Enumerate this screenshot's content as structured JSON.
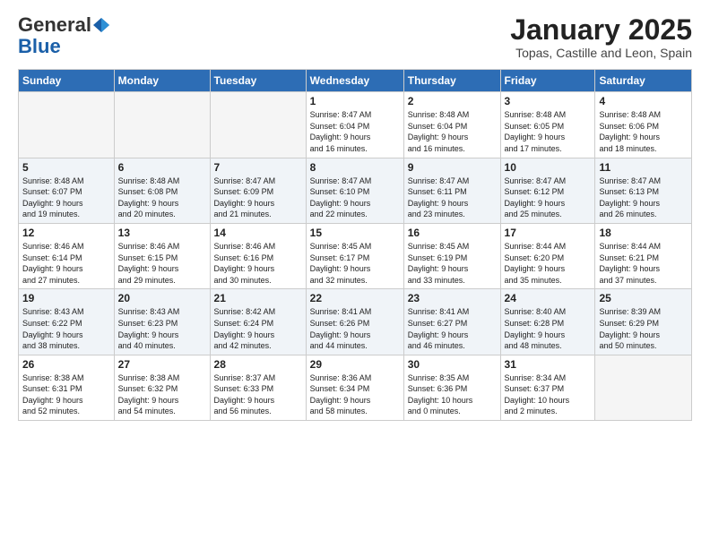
{
  "logo": {
    "general": "General",
    "blue": "Blue"
  },
  "title": "January 2025",
  "subtitle": "Topas, Castille and Leon, Spain",
  "days_of_week": [
    "Sunday",
    "Monday",
    "Tuesday",
    "Wednesday",
    "Thursday",
    "Friday",
    "Saturday"
  ],
  "weeks": [
    [
      {
        "day": "",
        "info": ""
      },
      {
        "day": "",
        "info": ""
      },
      {
        "day": "",
        "info": ""
      },
      {
        "day": "1",
        "info": "Sunrise: 8:47 AM\nSunset: 6:04 PM\nDaylight: 9 hours\nand 16 minutes."
      },
      {
        "day": "2",
        "info": "Sunrise: 8:48 AM\nSunset: 6:04 PM\nDaylight: 9 hours\nand 16 minutes."
      },
      {
        "day": "3",
        "info": "Sunrise: 8:48 AM\nSunset: 6:05 PM\nDaylight: 9 hours\nand 17 minutes."
      },
      {
        "day": "4",
        "info": "Sunrise: 8:48 AM\nSunset: 6:06 PM\nDaylight: 9 hours\nand 18 minutes."
      }
    ],
    [
      {
        "day": "5",
        "info": "Sunrise: 8:48 AM\nSunset: 6:07 PM\nDaylight: 9 hours\nand 19 minutes."
      },
      {
        "day": "6",
        "info": "Sunrise: 8:48 AM\nSunset: 6:08 PM\nDaylight: 9 hours\nand 20 minutes."
      },
      {
        "day": "7",
        "info": "Sunrise: 8:47 AM\nSunset: 6:09 PM\nDaylight: 9 hours\nand 21 minutes."
      },
      {
        "day": "8",
        "info": "Sunrise: 8:47 AM\nSunset: 6:10 PM\nDaylight: 9 hours\nand 22 minutes."
      },
      {
        "day": "9",
        "info": "Sunrise: 8:47 AM\nSunset: 6:11 PM\nDaylight: 9 hours\nand 23 minutes."
      },
      {
        "day": "10",
        "info": "Sunrise: 8:47 AM\nSunset: 6:12 PM\nDaylight: 9 hours\nand 25 minutes."
      },
      {
        "day": "11",
        "info": "Sunrise: 8:47 AM\nSunset: 6:13 PM\nDaylight: 9 hours\nand 26 minutes."
      }
    ],
    [
      {
        "day": "12",
        "info": "Sunrise: 8:46 AM\nSunset: 6:14 PM\nDaylight: 9 hours\nand 27 minutes."
      },
      {
        "day": "13",
        "info": "Sunrise: 8:46 AM\nSunset: 6:15 PM\nDaylight: 9 hours\nand 29 minutes."
      },
      {
        "day": "14",
        "info": "Sunrise: 8:46 AM\nSunset: 6:16 PM\nDaylight: 9 hours\nand 30 minutes."
      },
      {
        "day": "15",
        "info": "Sunrise: 8:45 AM\nSunset: 6:17 PM\nDaylight: 9 hours\nand 32 minutes."
      },
      {
        "day": "16",
        "info": "Sunrise: 8:45 AM\nSunset: 6:19 PM\nDaylight: 9 hours\nand 33 minutes."
      },
      {
        "day": "17",
        "info": "Sunrise: 8:44 AM\nSunset: 6:20 PM\nDaylight: 9 hours\nand 35 minutes."
      },
      {
        "day": "18",
        "info": "Sunrise: 8:44 AM\nSunset: 6:21 PM\nDaylight: 9 hours\nand 37 minutes."
      }
    ],
    [
      {
        "day": "19",
        "info": "Sunrise: 8:43 AM\nSunset: 6:22 PM\nDaylight: 9 hours\nand 38 minutes."
      },
      {
        "day": "20",
        "info": "Sunrise: 8:43 AM\nSunset: 6:23 PM\nDaylight: 9 hours\nand 40 minutes."
      },
      {
        "day": "21",
        "info": "Sunrise: 8:42 AM\nSunset: 6:24 PM\nDaylight: 9 hours\nand 42 minutes."
      },
      {
        "day": "22",
        "info": "Sunrise: 8:41 AM\nSunset: 6:26 PM\nDaylight: 9 hours\nand 44 minutes."
      },
      {
        "day": "23",
        "info": "Sunrise: 8:41 AM\nSunset: 6:27 PM\nDaylight: 9 hours\nand 46 minutes."
      },
      {
        "day": "24",
        "info": "Sunrise: 8:40 AM\nSunset: 6:28 PM\nDaylight: 9 hours\nand 48 minutes."
      },
      {
        "day": "25",
        "info": "Sunrise: 8:39 AM\nSunset: 6:29 PM\nDaylight: 9 hours\nand 50 minutes."
      }
    ],
    [
      {
        "day": "26",
        "info": "Sunrise: 8:38 AM\nSunset: 6:31 PM\nDaylight: 9 hours\nand 52 minutes."
      },
      {
        "day": "27",
        "info": "Sunrise: 8:38 AM\nSunset: 6:32 PM\nDaylight: 9 hours\nand 54 minutes."
      },
      {
        "day": "28",
        "info": "Sunrise: 8:37 AM\nSunset: 6:33 PM\nDaylight: 9 hours\nand 56 minutes."
      },
      {
        "day": "29",
        "info": "Sunrise: 8:36 AM\nSunset: 6:34 PM\nDaylight: 9 hours\nand 58 minutes."
      },
      {
        "day": "30",
        "info": "Sunrise: 8:35 AM\nSunset: 6:36 PM\nDaylight: 10 hours\nand 0 minutes."
      },
      {
        "day": "31",
        "info": "Sunrise: 8:34 AM\nSunset: 6:37 PM\nDaylight: 10 hours\nand 2 minutes."
      },
      {
        "day": "",
        "info": ""
      }
    ]
  ]
}
